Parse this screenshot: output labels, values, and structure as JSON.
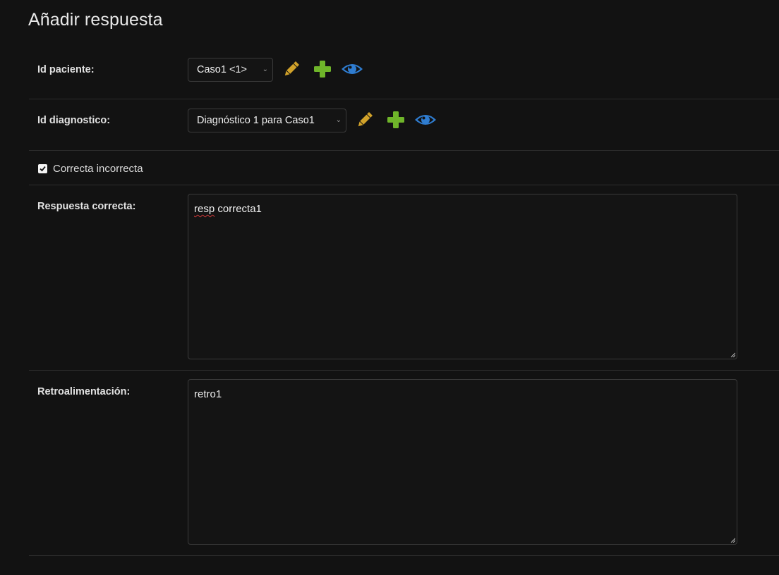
{
  "page": {
    "title": "Añadir respuesta"
  },
  "fields": {
    "id_paciente": {
      "label": "Id paciente:",
      "value": "Caso1 <1>"
    },
    "id_diagnostico": {
      "label": "Id diagnostico:",
      "value": "Diagnóstico 1 para Caso1"
    },
    "correcta": {
      "label": "Correcta incorrecta",
      "checked": true
    },
    "respuesta_correcta": {
      "label": "Respuesta correcta:",
      "value_word1": "resp",
      "value_rest": " correcta1"
    },
    "retroalimentacion": {
      "label": "Retroalimentación:",
      "value": "retro1"
    }
  },
  "icons": {
    "edit": "pencil-icon",
    "add": "plus-icon",
    "view": "eye-icon"
  },
  "colors": {
    "background": "#121212",
    "edit": "#d1a22a",
    "add": "#6fb52a",
    "view": "#2f7dd1"
  }
}
